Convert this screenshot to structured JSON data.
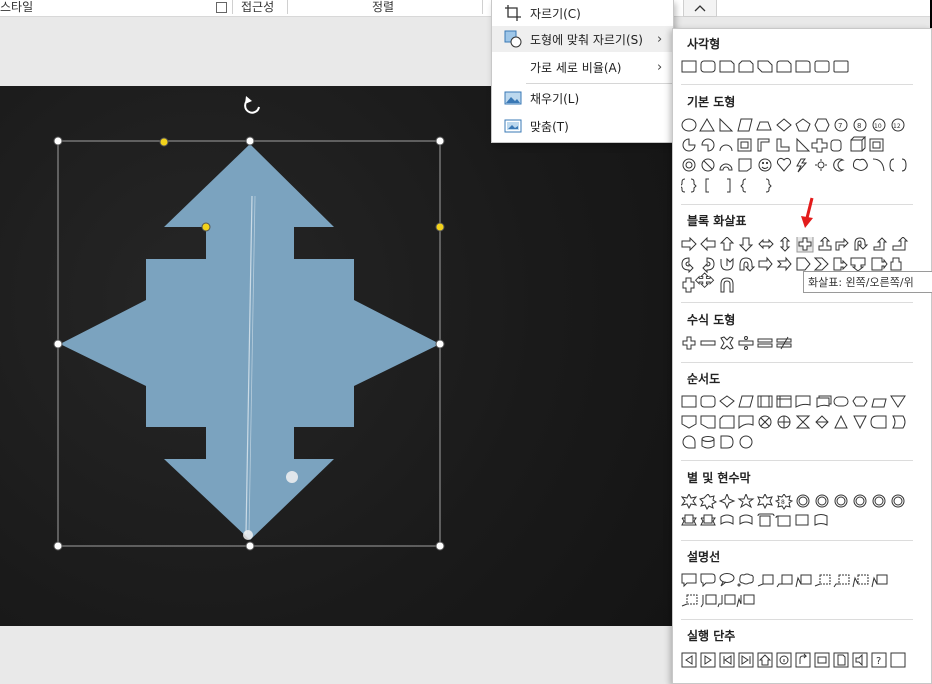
{
  "ribbon": {
    "style_label": "스타일",
    "accessibility_label": "접근성",
    "arrange_label": "정렬"
  },
  "context_menu": {
    "items": [
      {
        "label": "자르기(C)",
        "icon": "crop-icon"
      },
      {
        "label": "도형에 맞춰 자르기(S)",
        "icon": "crop-to-shape-icon",
        "submenu": true
      },
      {
        "label": "가로 세로 비율(A)",
        "icon": "",
        "submenu": true
      },
      {
        "label": "채우기(L)",
        "icon": "fill-picture-icon"
      },
      {
        "label": "맞춤(T)",
        "icon": "fit-picture-icon"
      }
    ]
  },
  "gallery": {
    "sections": [
      {
        "title": "사각형"
      },
      {
        "title": "기본 도형"
      },
      {
        "title": "블록 화살표"
      },
      {
        "title": "수식 도형"
      },
      {
        "title": "순서도"
      },
      {
        "title": "별 및 현수막"
      },
      {
        "title": "설명선"
      },
      {
        "title": "실행 단추"
      }
    ],
    "tooltip": "화살표: 왼쪽/오른쪽/위"
  },
  "colors": {
    "shape_fill": "#7ba3bf",
    "slide_bg": "#1b1b1b",
    "handle_yellow": "#f2d21b",
    "pointer_red": "#e31b1b"
  }
}
